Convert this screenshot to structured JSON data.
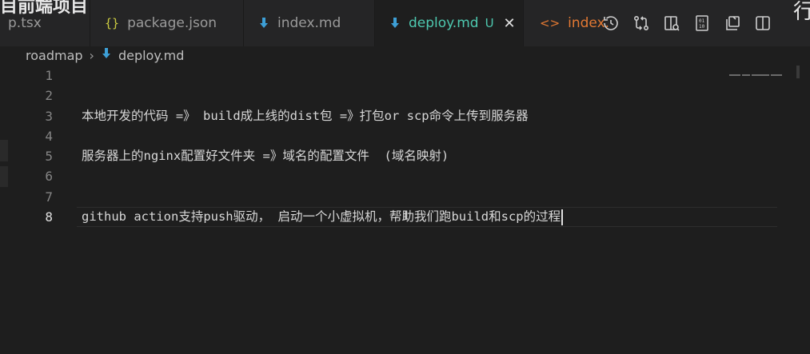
{
  "tabs": [
    {
      "label": "p.tsx",
      "icon": "react-file-icon"
    },
    {
      "label": "package.json",
      "icon": "json-braces-icon"
    },
    {
      "label": "index.md",
      "icon": "markdown-icon"
    },
    {
      "label": "deploy.md",
      "icon": "markdown-icon",
      "active": true,
      "status": "U"
    },
    {
      "label": "index.",
      "icon": "html-icon"
    }
  ],
  "breadcrumb": {
    "folder": "roadmap",
    "file": "deploy.md"
  },
  "editor": {
    "lines": [
      {
        "number": "1",
        "text": ""
      },
      {
        "number": "2",
        "text": ""
      },
      {
        "number": "3",
        "text": "本地开发的代码 =》 build成上线的dist包 =》打包or scp命令上传到服务器"
      },
      {
        "number": "4",
        "text": ""
      },
      {
        "number": "5",
        "text": "服务器上的nginx配置好文件夹 =》域名的配置文件  (域名映射)"
      },
      {
        "number": "6",
        "text": ""
      },
      {
        "number": "7",
        "text": ""
      },
      {
        "number": "8",
        "text": "github action支持push驱动， 启动一个小虚拟机，帮助我们跑build和scp的过程"
      }
    ],
    "current_line": "8"
  },
  "corner_glyph": "行",
  "top_glyph": "目前端项目",
  "colors": {
    "background": "#1e1e1e",
    "tabbar": "#252526",
    "active_tab_text": "#4ec9b0",
    "markdown_icon": "#3d9fd6",
    "json_icon": "#cbcb41",
    "html_icon": "#e37933"
  }
}
